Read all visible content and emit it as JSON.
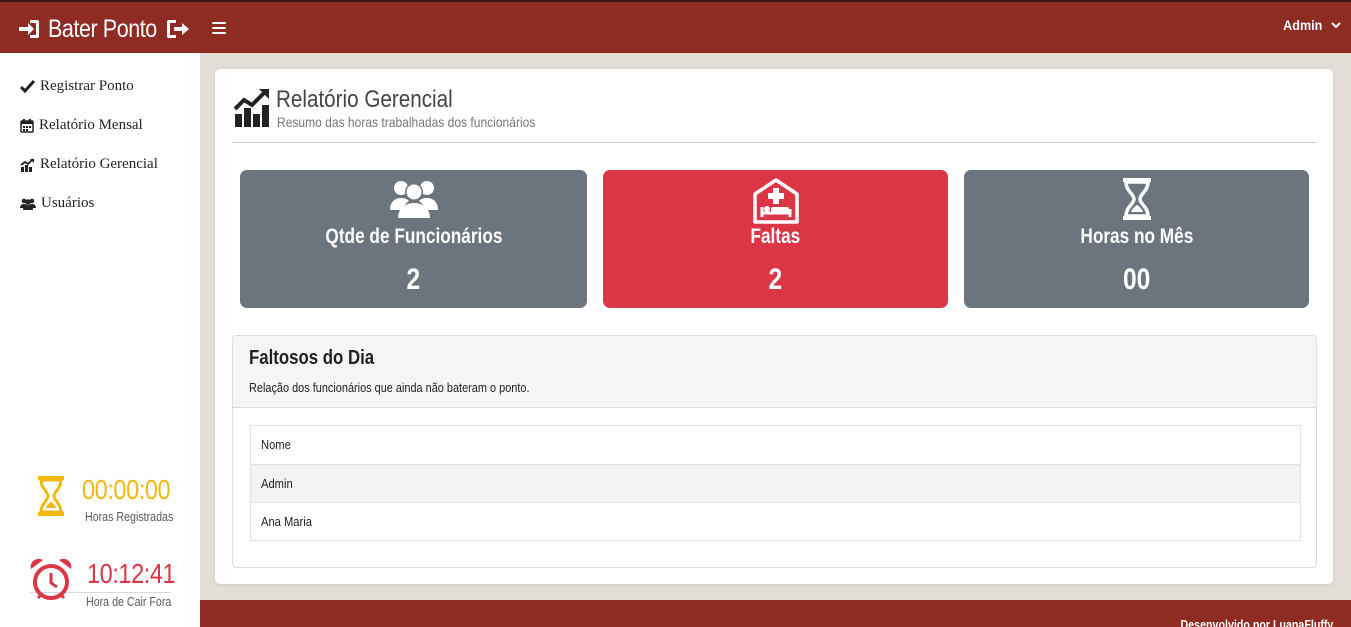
{
  "app": {
    "brand_title": "Bater Ponto"
  },
  "navbar": {
    "user_name": "Admin"
  },
  "sidebar": {
    "items": [
      {
        "label": "Registrar Ponto",
        "icon": "check-icon"
      },
      {
        "label": "Relatório Mensal",
        "icon": "calendar-icon"
      },
      {
        "label": "Relatório Gerencial",
        "icon": "chart-icon"
      },
      {
        "label": "Usuários",
        "icon": "users-icon"
      }
    ],
    "worked": {
      "time": "00:00:00",
      "label": "Horas Registradas",
      "color": "#f0b90c"
    },
    "exit": {
      "time": "10:12:41",
      "label": "Hora de Cair Fora",
      "color": "#dc3545"
    }
  },
  "page": {
    "title": "Relatório Gerencial",
    "subtitle": "Resumo das horas trabalhadas dos funcionários"
  },
  "stats": [
    {
      "label": "Qtde de Funcionários",
      "value": "2",
      "color": "#6c757d",
      "icon": "users-icon"
    },
    {
      "label": "Faltas",
      "value": "2",
      "color": "#dc3545",
      "icon": "hospital-bed-icon"
    },
    {
      "label": "Horas no Mês",
      "value": "00",
      "color": "#6c757d",
      "icon": "hourglass-icon"
    }
  ],
  "absentees": {
    "title": "Faltosos do Dia",
    "description": "Relação dos funcionários que ainda não bateram o ponto.",
    "table": {
      "header": "Nome",
      "rows": [
        "Admin",
        "Ana Maria"
      ]
    }
  },
  "footer": {
    "text": "Desenvolvido por LuanaFluffy"
  },
  "theme": {
    "primary": "#8e2b22",
    "background": "#e3ddd7"
  }
}
